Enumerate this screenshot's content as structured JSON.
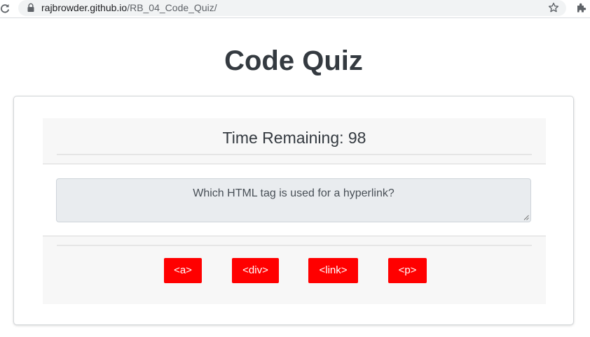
{
  "browser": {
    "url_host": "rajbrowder.github.io",
    "url_path": "/RB_04_Code_Quiz/"
  },
  "page": {
    "title": "Code Quiz"
  },
  "quiz": {
    "timer_text": "Time Remaining: 98",
    "question": "Which HTML tag is used for a hyperlink?",
    "answers": [
      "<a>",
      "<div>",
      "<link>",
      "<p>"
    ]
  },
  "colors": {
    "answer_button_bg": "#ff0000",
    "answer_button_text": "#ffffff",
    "title": "#343a40",
    "section_bg": "#f7f7f7",
    "question_bg": "#e9ecef"
  },
  "icons": {
    "reload": "reload-icon",
    "lock": "lock-icon",
    "star": "star-icon",
    "extensions": "puzzle-icon"
  }
}
